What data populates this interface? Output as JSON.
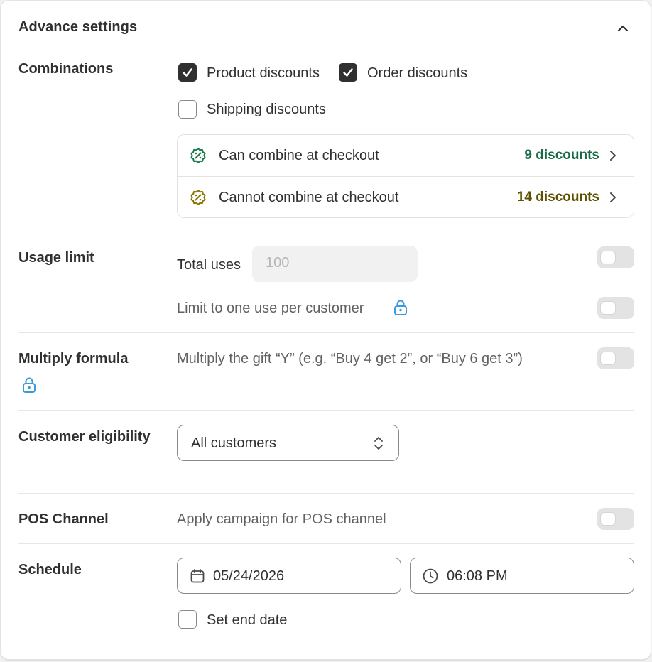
{
  "header": {
    "title": "Advance settings",
    "collapse_icon": "chevron-up-icon"
  },
  "combinations": {
    "label": "Combinations",
    "options": [
      {
        "label": "Product discounts",
        "checked": true
      },
      {
        "label": "Order discounts",
        "checked": true
      },
      {
        "label": "Shipping discounts",
        "checked": false
      }
    ],
    "rows": [
      {
        "label": "Can combine at checkout",
        "count": "9 discounts",
        "color": "#1a7a4a",
        "icon": "discount-badge-icon"
      },
      {
        "label": "Cannot combine at checkout",
        "count": "14 discounts",
        "color": "#8a7400",
        "icon": "discount-badge-icon"
      }
    ]
  },
  "usage_limit": {
    "label": "Usage limit",
    "total_uses_label": "Total uses",
    "total_uses_placeholder": "100",
    "one_per_customer_label": "Limit to one use per customer",
    "lock_color": "#3b9ad9"
  },
  "multiply_formula": {
    "label": "Multiply formula",
    "description": "Multiply the gift “Y” (e.g. “Buy 4 get 2”, or “Buy 6 get 3”)"
  },
  "customer_eligibility": {
    "label": "Customer eligibility",
    "selected": "All customers"
  },
  "pos_channel": {
    "label": "POS Channel",
    "description": "Apply campaign for POS channel"
  },
  "schedule": {
    "label": "Schedule",
    "date": "05/24/2026",
    "time": "06:08 PM",
    "end_date_label": "Set end date"
  }
}
